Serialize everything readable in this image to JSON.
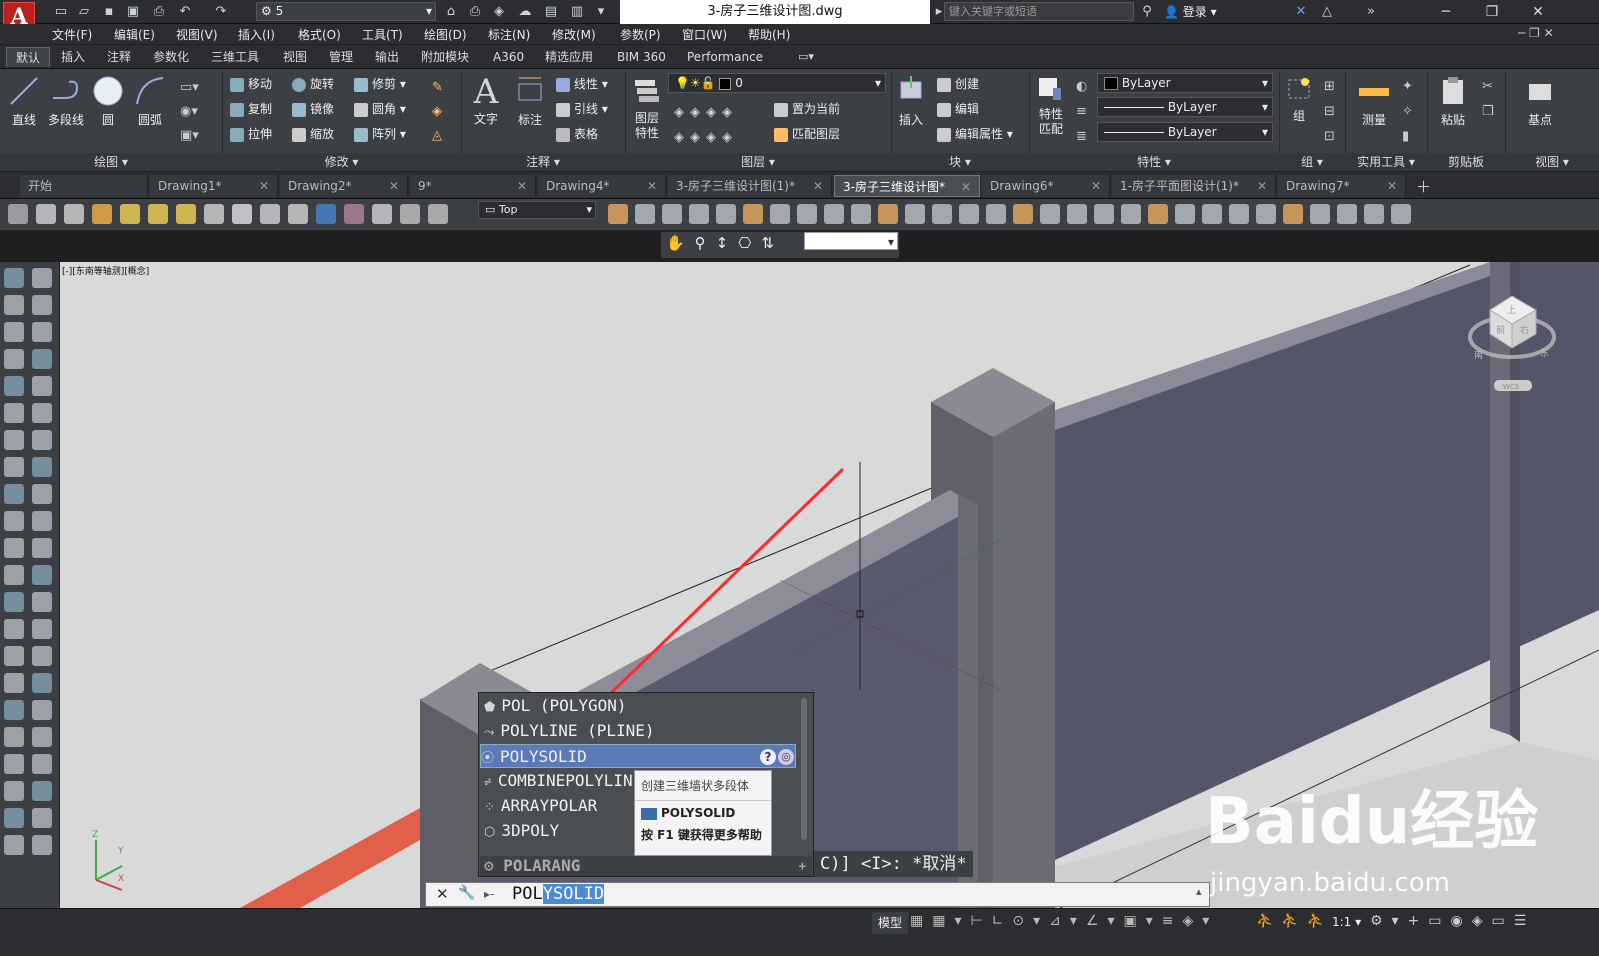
{
  "titlebar": {
    "app_logo": "A",
    "workspace": "5",
    "doc_title": "3-房子三维设计图.dwg",
    "search_placeholder": "键入关键字或短语",
    "login": "登录"
  },
  "menubar": [
    "文件(F)",
    "编辑(E)",
    "视图(V)",
    "插入(I)",
    "格式(O)",
    "工具(T)",
    "绘图(D)",
    "标注(N)",
    "修改(M)",
    "参数(P)",
    "窗口(W)",
    "帮助(H)"
  ],
  "ribbon_tabs": [
    "默认",
    "插入",
    "注释",
    "参数化",
    "三维工具",
    "视图",
    "管理",
    "输出",
    "附加模块",
    "A360",
    "精选应用",
    "BIM 360",
    "Performance"
  ],
  "ribbon": {
    "draw": {
      "title": "绘图",
      "line": "直线",
      "polyline": "多段线",
      "circle": "圆",
      "arc": "圆弧"
    },
    "modify": {
      "title": "修改",
      "move": "移动",
      "rotate": "旋转",
      "trim": "修剪",
      "copy": "复制",
      "mirror": "镜像",
      "fillet": "圆角",
      "stretch": "拉伸",
      "scale": "缩放",
      "array": "阵列"
    },
    "annotation": {
      "title": "注释",
      "text": "文字",
      "dimension": "标注",
      "linear": "线性",
      "leader": "引线",
      "table": "表格"
    },
    "layers": {
      "title": "图层",
      "layer_props": "图层特性",
      "current_layer": "0",
      "set_current": "置为当前",
      "match_layer": "匹配图层"
    },
    "block": {
      "title": "块",
      "insert": "插入",
      "create": "创建",
      "edit": "编辑",
      "edit_attr": "编辑属性"
    },
    "properties": {
      "title": "特性",
      "match": "特性匹配",
      "color": "ByLayer",
      "linetype": "ByLayer",
      "lineweight": "ByLayer"
    },
    "groups": {
      "title": "组",
      "group": "组"
    },
    "utilities": {
      "title": "实用工具",
      "measure": "测量"
    },
    "clipboard": {
      "title": "剪贴板",
      "paste": "粘贴"
    },
    "view": {
      "title": "视图",
      "base": "基点"
    }
  },
  "doc_tabs": [
    "开始",
    "Drawing1*",
    "Drawing2*",
    "9*",
    "Drawing4*",
    "3-房子三维设计图(1)*",
    "3-房子三维设计图*",
    "Drawing6*",
    "1-房子平面图设计(1)*",
    "Drawing7*"
  ],
  "toolbar": {
    "view_select": "Top"
  },
  "viewport": {
    "label": "[-][东南等轴测][概念]",
    "viewcube_top": "上",
    "viewcube_front": "前",
    "viewcube_right": "右",
    "viewcube_south": "南",
    "viewcube_east": "东",
    "wcs_label": "WCS"
  },
  "autocomplete": {
    "items": [
      {
        "text": "POL (POLYGON)",
        "selected": false
      },
      {
        "text": "POLYLINE (PLINE)",
        "selected": false
      },
      {
        "text": "POLYSOLID",
        "selected": true
      },
      {
        "text": "COMBINEPOLYLINES",
        "selected": false
      },
      {
        "text": "ARRAYPOLAR",
        "selected": false
      },
      {
        "text": "3DPOLY",
        "selected": false
      }
    ],
    "footer": "POLARANG",
    "tooltip_desc": "创建三维墙状多段体",
    "tooltip_cmd": "POLYSOLID",
    "tooltip_help": "按 F1 键获得更多帮助"
  },
  "command": {
    "prompt_tail": "C)] <I>: *取消*",
    "typed_plain": "POL",
    "typed_highlight": "YSOLID"
  },
  "statusbar": {
    "model": "模型",
    "scale": "1:1"
  },
  "watermark": {
    "brand": "Baidu经验",
    "url": "jingyan.baidu.com"
  },
  "colors": {
    "accent_red": "#ff2b2b",
    "selection": "#5a7bb8",
    "ribbon_bg": "#3c3f43",
    "viewport_bg": "#d9d9d9"
  }
}
